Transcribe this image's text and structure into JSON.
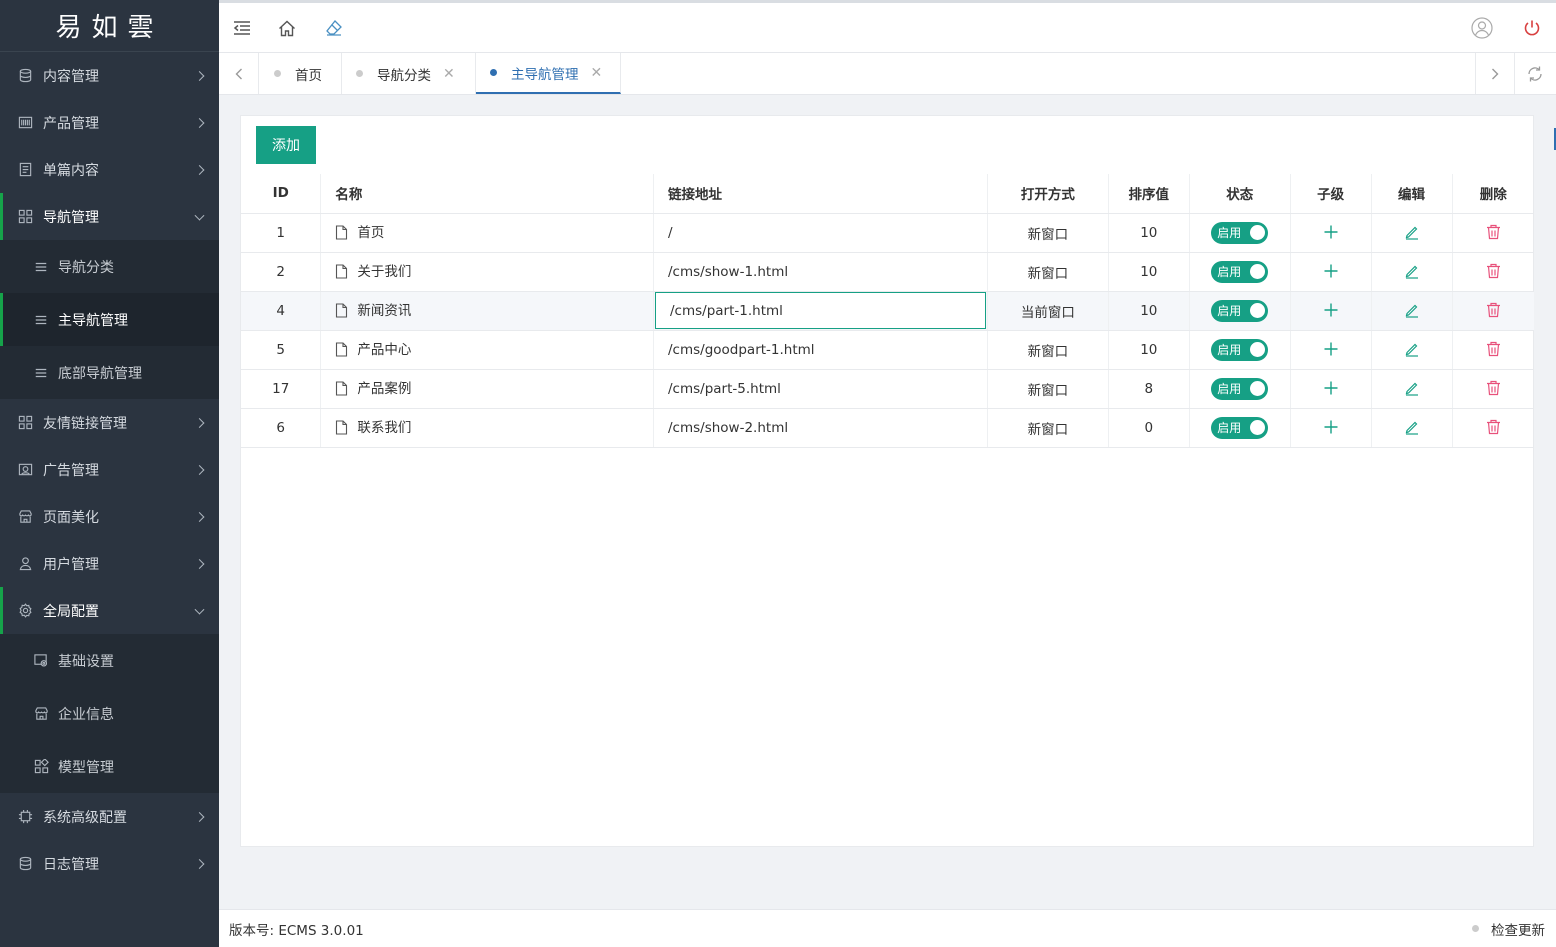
{
  "app": {
    "logo": "易如雲"
  },
  "sidebar": {
    "items": [
      {
        "label": "内容管理",
        "icon": "database-icon"
      },
      {
        "label": "产品管理",
        "icon": "barcode-icon"
      },
      {
        "label": "单篇内容",
        "icon": "document-icon"
      },
      {
        "label": "导航管理",
        "icon": "grid-icon",
        "open": true,
        "children": [
          {
            "label": "导航分类",
            "icon": "list-icon"
          },
          {
            "label": "主导航管理",
            "icon": "list-icon",
            "active": true
          },
          {
            "label": "底部导航管理",
            "icon": "list-icon"
          }
        ]
      },
      {
        "label": "友情链接管理",
        "icon": "grid-icon"
      },
      {
        "label": "广告管理",
        "icon": "image-icon"
      },
      {
        "label": "页面美化",
        "icon": "store-icon"
      },
      {
        "label": "用户管理",
        "icon": "user-icon"
      },
      {
        "label": "全局配置",
        "icon": "gear-icon",
        "open": true,
        "children": [
          {
            "label": "基础设置",
            "icon": "settings-window-icon"
          },
          {
            "label": "企业信息",
            "icon": "store-icon"
          },
          {
            "label": "模型管理",
            "icon": "apps-icon"
          }
        ]
      },
      {
        "label": "系统高级配置",
        "icon": "chip-icon"
      },
      {
        "label": "日志管理",
        "icon": "database-icon"
      }
    ]
  },
  "tabs": [
    {
      "label": "首页",
      "closable": false
    },
    {
      "label": "导航分类",
      "closable": true
    },
    {
      "label": "主导航管理",
      "closable": true,
      "active": true
    }
  ],
  "toolbar": {
    "add_label": "添加"
  },
  "table": {
    "headers": [
      "ID",
      "名称",
      "链接地址",
      "打开方式",
      "排序值",
      "状态",
      "子级",
      "编辑",
      "删除"
    ],
    "status_label": "启用",
    "rows": [
      {
        "id": "1",
        "name": "首页",
        "url": "/",
        "open": "新窗口",
        "sort": "10"
      },
      {
        "id": "2",
        "name": "关于我们",
        "url": "/cms/show-1.html",
        "open": "新窗口",
        "sort": "10"
      },
      {
        "id": "4",
        "name": "新闻资讯",
        "url": "/cms/part-1.html",
        "open": "当前窗口",
        "sort": "10",
        "editing": true
      },
      {
        "id": "5",
        "name": "产品中心",
        "url": "/cms/goodpart-1.html",
        "open": "新窗口",
        "sort": "10"
      },
      {
        "id": "17",
        "name": "产品案例",
        "url": "/cms/part-5.html",
        "open": "新窗口",
        "sort": "8"
      },
      {
        "id": "6",
        "name": "联系我们",
        "url": "/cms/show-2.html",
        "open": "新窗口",
        "sort": "0"
      }
    ]
  },
  "footer": {
    "version": "版本号: ECMS 3.0.01",
    "update_label": "检查更新"
  },
  "colors": {
    "accent": "#16a085",
    "active_tab": "#2f6fb1",
    "delete": "#e8517b",
    "sidebar_bg": "#2b3440"
  }
}
